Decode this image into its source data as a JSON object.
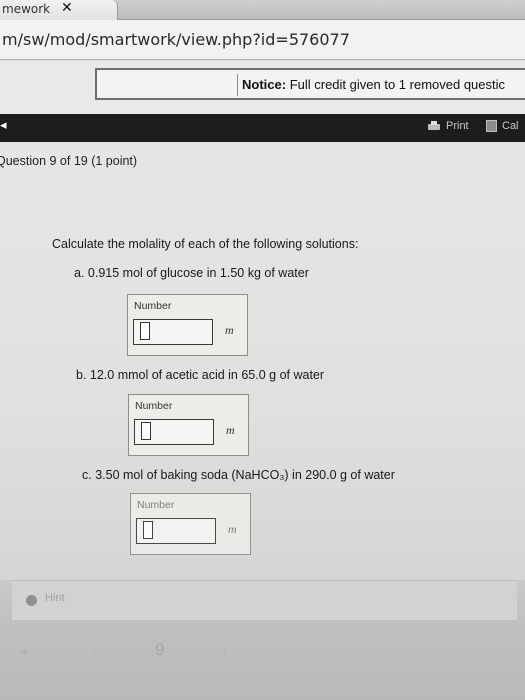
{
  "browser": {
    "tab_title": "mework",
    "tab_close": "✕",
    "url": "m/sw/mod/smartwork/view.php?id=576077"
  },
  "notice": {
    "label": "Notice:",
    "text": "Full credit given to 1 removed questic"
  },
  "toolbar": {
    "print_label": "Print",
    "calc_label": "Cal"
  },
  "question": {
    "header": "Question 9 of 19 (1 point)",
    "prompt": "Calculate the molality of each of the following solutions:",
    "parts": [
      {
        "text": "a. 0.915 mol of glucose in 1.50 kg of water",
        "input_label": "Number",
        "unit": "m",
        "value": ""
      },
      {
        "text": "b. 12.0 mmol of acetic acid in 65.0 g of water",
        "input_label": "Number",
        "unit": "m",
        "value": ""
      },
      {
        "text": "c. 3.50 mol of baking soda (NaHCO₃) in 290.0 g of water",
        "input_label": "Number",
        "unit": "m",
        "value": ""
      }
    ]
  },
  "footer": {
    "hint_label": "Hint",
    "page_number": "9"
  }
}
